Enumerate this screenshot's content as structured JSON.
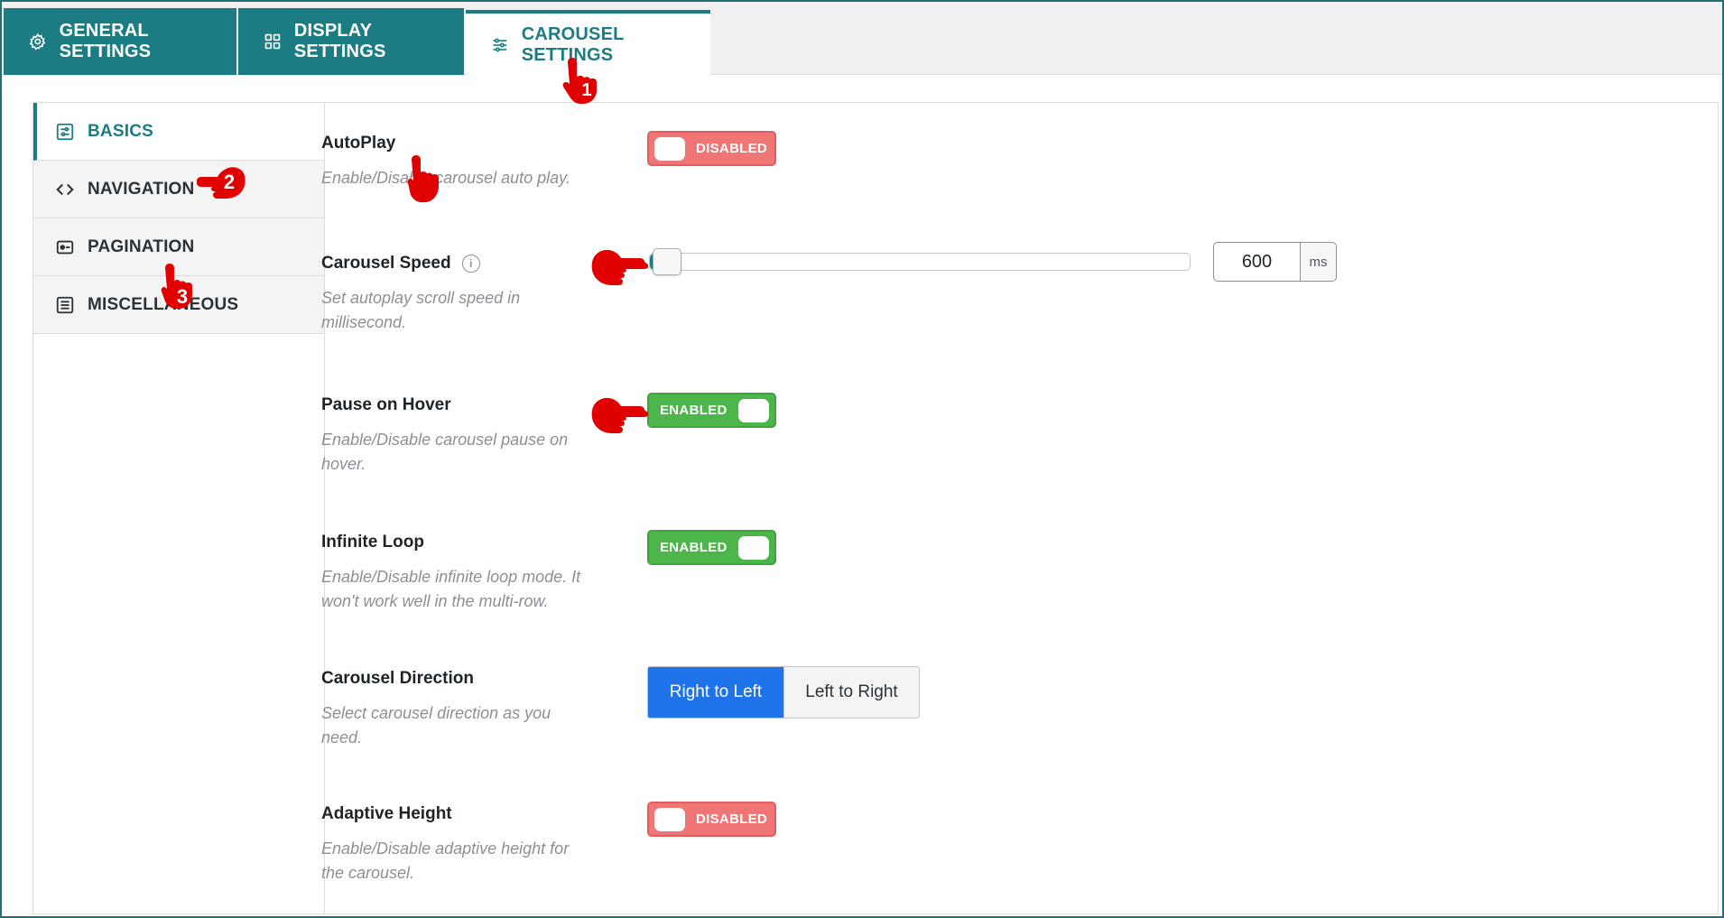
{
  "tabs": [
    {
      "label": "GENERAL SETTINGS",
      "icon": "gear-icon"
    },
    {
      "label": "DISPLAY SETTINGS",
      "icon": "grid-icon"
    },
    {
      "label": "CAROUSEL SETTINGS",
      "icon": "sliders-icon",
      "active": true
    }
  ],
  "sidenav": [
    {
      "label": "BASICS",
      "icon": "sliders-icon",
      "active": true
    },
    {
      "label": "NAVIGATION",
      "icon": "code-arrows-icon"
    },
    {
      "label": "PAGINATION",
      "icon": "pagination-icon"
    },
    {
      "label": "MISCELLANEOUS",
      "icon": "list-icon"
    }
  ],
  "settings": {
    "autoplay": {
      "title": "AutoPlay",
      "desc": "Enable/Disable carousel auto play.",
      "state": "DISABLED"
    },
    "speed": {
      "title": "Carousel Speed",
      "desc": "Set autoplay scroll speed in millisecond.",
      "value": "600",
      "unit": "ms",
      "slider_fraction": 0.005
    },
    "pause_hover": {
      "title": "Pause on Hover",
      "desc": "Enable/Disable carousel pause on hover.",
      "state": "ENABLED"
    },
    "infinite_loop": {
      "title": "Infinite Loop",
      "desc": "Enable/Disable infinite loop mode. It won't work well in the multi-row.",
      "state": "ENABLED"
    },
    "direction": {
      "title": "Carousel Direction",
      "desc": "Select carousel direction as you need.",
      "options": [
        "Right to Left",
        "Left to Right"
      ],
      "selected": "Right to Left"
    },
    "adaptive_height": {
      "title": "Adaptive Height",
      "desc": "Enable/Disable adaptive height for the carousel.",
      "state": "DISABLED"
    }
  },
  "annotations": {
    "step1": "1",
    "step2": "2",
    "step3": "3"
  },
  "colors": {
    "accent": "#1b7d83",
    "enabled": "#4cb64a",
    "disabled": "#f07575",
    "primary_button": "#1e73e8",
    "annotation": "#e00000"
  }
}
